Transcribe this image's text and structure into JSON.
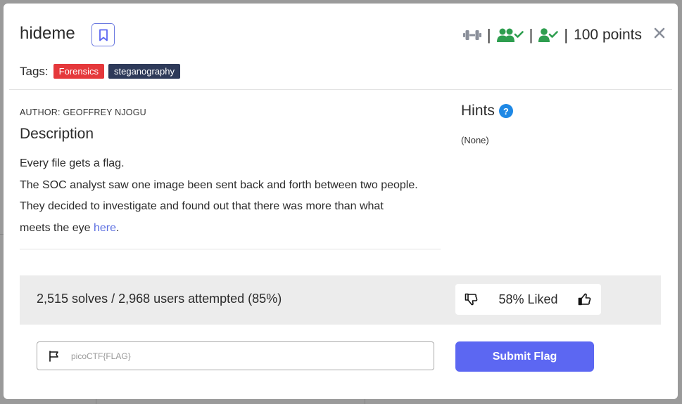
{
  "challenge": {
    "title": "hideme",
    "points": "100 points",
    "tags_label": "Tags:",
    "tags": [
      {
        "label": "Forensics",
        "color": "#e5383b"
      },
      {
        "label": "steganography",
        "color": "#2e3a59"
      }
    ],
    "author": "AUTHOR: GEOFFREY NJOGU",
    "description_title": "Description",
    "description_lines": [
      "Every file gets a flag.",
      "The SOC analyst saw one image been sent back and forth between two people.",
      "They decided to investigate and found out that there was more than what"
    ],
    "description_last_prefix": "meets the eye ",
    "description_link": "here",
    "description_last_suffix": ".",
    "hints_title": "Hints",
    "hints_value": "(None)"
  },
  "stats": {
    "solves_text": "2,515 solves / 2,968 users attempted (85%)",
    "liked_text": "58% Liked"
  },
  "flag_form": {
    "placeholder": "picoCTF{FLAG}",
    "submit_label": "Submit Flag"
  },
  "icons": {
    "bookmark": "bookmark-icon",
    "difficulty": "dumbbell-icon",
    "users_solved": "users-check-icon",
    "user_solved": "user-check-icon",
    "close": "close-icon",
    "hint_help": "question-circle-icon",
    "thumbs_down": "thumbs-down-icon",
    "thumbs_up": "thumbs-up-icon",
    "flag": "flag-icon"
  },
  "colors": {
    "accent": "#5c67f2",
    "link": "#5b6ee1",
    "solved_green": "#2e9e4f",
    "tag_forensics": "#e5383b",
    "tag_stego": "#2e3a59"
  }
}
